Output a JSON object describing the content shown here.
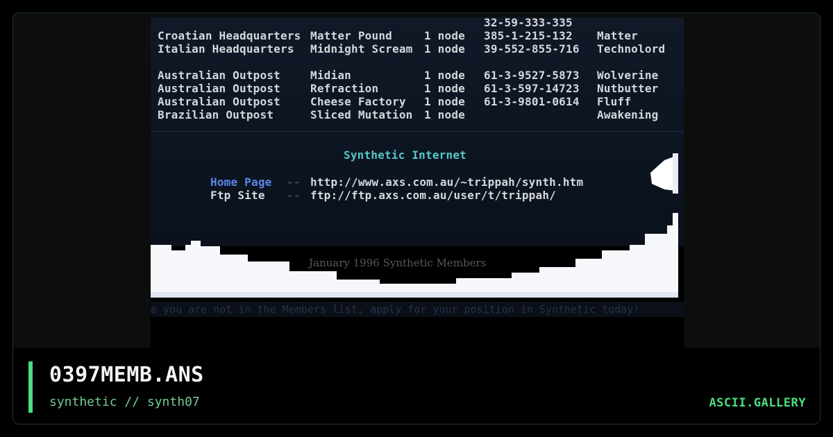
{
  "art": {
    "phone_top": "32-59-333-335",
    "bbs_rows_a": [
      {
        "name": "Croatian Headquarters",
        "board": "Matter Pound",
        "nodes": "1 node",
        "phone": "385-1-215-132",
        "sysop": "Matter"
      },
      {
        "name": "Italian Headquarters",
        "board": "Midnight Scream",
        "nodes": "1 node",
        "phone": "39-552-855-716",
        "sysop": "Technolord"
      }
    ],
    "bbs_rows_b": [
      {
        "name": "Australian Outpost",
        "board": "Midian",
        "nodes": "1 node",
        "phone": "61-3-9527-5873",
        "sysop": "Wolverine"
      },
      {
        "name": "Australian Outpost",
        "board": "Refraction",
        "nodes": "1 node",
        "phone": "61-3-597-14723",
        "sysop": "Nutbutter"
      },
      {
        "name": "Australian Outpost",
        "board": "Cheese Factory",
        "nodes": "1 node",
        "phone": "61-3-9801-0614",
        "sysop": "Fluff"
      },
      {
        "name": "Brazilian Outpost",
        "board": "Sliced Mutation",
        "nodes": "1 node",
        "phone": "",
        "sysop": "Awakening"
      }
    ],
    "section_title": "Synthetic Internet",
    "links": [
      {
        "label": "Home Page",
        "sep": "--",
        "url": "http://www.axs.com.au/~trippah/synth.htm"
      },
      {
        "label": "Ftp Site",
        "sep": "--",
        "url": "ftp://ftp.axs.com.au/user/t/trippah/"
      }
    ],
    "credit": "January 1996 Synthetic Members",
    "scroller": "e you are not in the Members list, apply for your position in Synthetic today!"
  },
  "footer": {
    "filename": "0397MEMB.ANS",
    "subtitle": "synthetic // synth07",
    "brand": "ASCII.GALLERY"
  },
  "colors": {
    "accent": "#4ade80",
    "cyan_title": "#57c7c7",
    "link_blue": "#5b86e6"
  }
}
